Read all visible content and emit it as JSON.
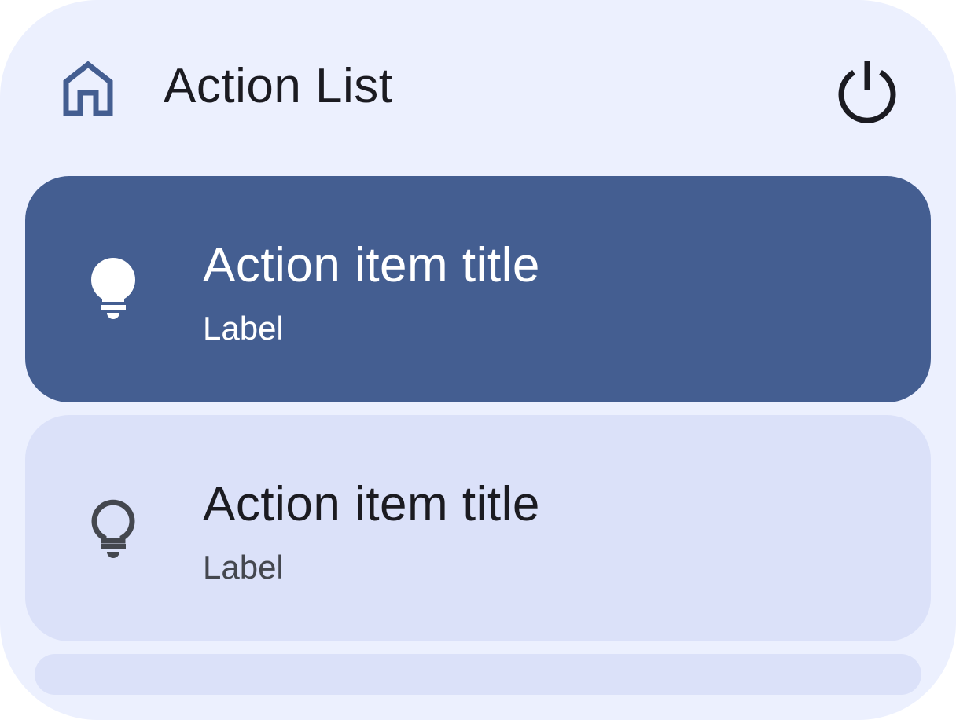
{
  "app": {
    "title": "Action List"
  },
  "header": {
    "home_icon": "home-icon",
    "power_icon": "power-icon"
  },
  "items": [
    {
      "title": "Action item title",
      "label": "Label",
      "icon": "lightbulb-filled-icon",
      "selected": true
    },
    {
      "title": "Action item title",
      "label": "Label",
      "icon": "lightbulb-outline-icon",
      "selected": false
    }
  ],
  "colors": {
    "background": "#ecf0fe",
    "primary": "#445e91",
    "surface_item": "#dbe1f9",
    "on_surface": "#1b1b21",
    "on_surface_variant": "#44474f",
    "on_primary": "#ffffff"
  }
}
